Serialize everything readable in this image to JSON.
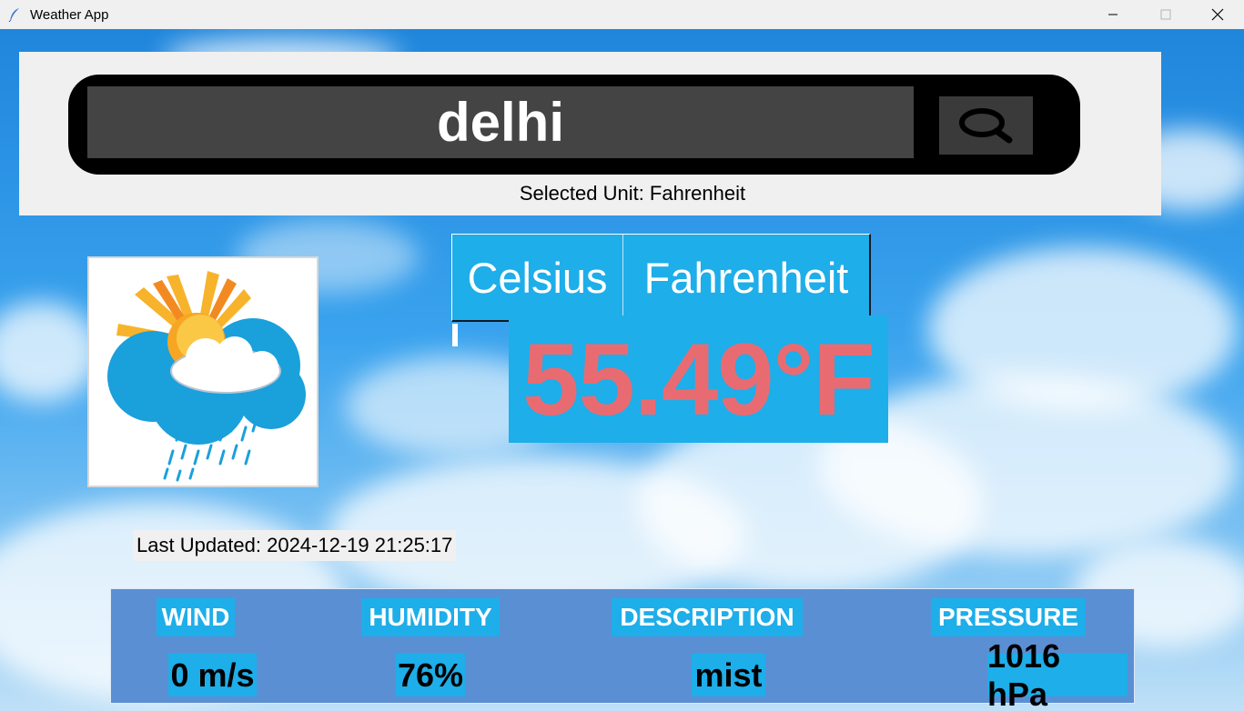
{
  "window": {
    "title": "Weather App",
    "icon": "feather-icon",
    "controls": [
      "minimize-icon",
      "maximize-icon",
      "close-icon"
    ]
  },
  "search": {
    "value": "delhi",
    "button_icon": "search-icon"
  },
  "unit_label": "Selected Unit: Fahrenheit",
  "unit_toggle": {
    "celsius": "Celsius",
    "fahrenheit": "Fahrenheit",
    "selected": "Fahrenheit"
  },
  "temperature": "55.49°F",
  "weather_icon": "sun-cloud-rain-icon",
  "last_updated": "Last Updated: 2024-12-19 21:25:17",
  "stats": {
    "wind": {
      "label": "WIND",
      "value": "0 m/s"
    },
    "humidity": {
      "label": "HUMIDITY",
      "value": "76%"
    },
    "description": {
      "label": "DESCRIPTION",
      "value": "mist"
    },
    "pressure": {
      "label": "PRESSURE",
      "value": "1016 hPa"
    }
  },
  "colors": {
    "accent": "#1eaee9",
    "temperature_text": "#e96b72",
    "stats_panel": "#5a8fd4",
    "search_pill": "#000000",
    "search_input": "#444444"
  }
}
